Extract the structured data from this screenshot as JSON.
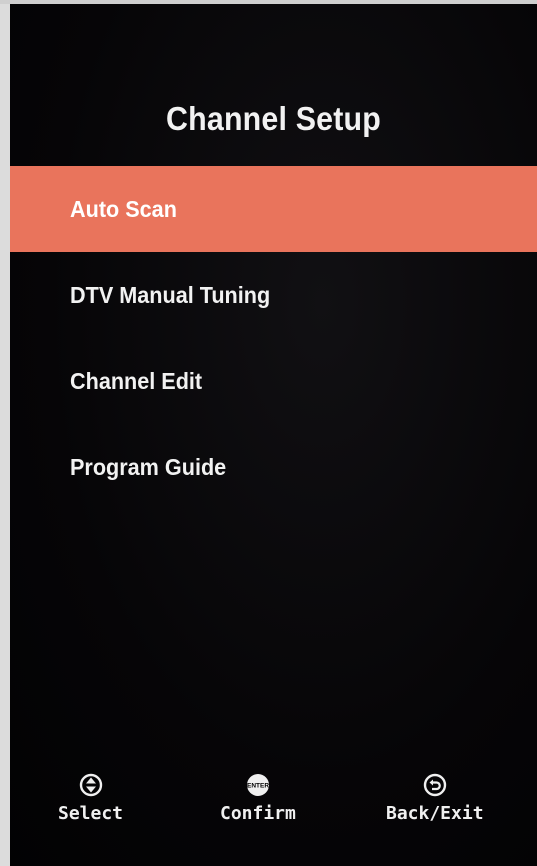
{
  "screen": {
    "title": "Channel Setup"
  },
  "menu": {
    "selected_index": 0,
    "selected_color": "#e9745c",
    "items": [
      {
        "label": "Auto Scan"
      },
      {
        "label": "DTV Manual Tuning"
      },
      {
        "label": "Channel Edit"
      },
      {
        "label": "Program Guide"
      }
    ]
  },
  "footer": {
    "select": {
      "label": "Select",
      "icon": "up-down-arrows-icon"
    },
    "confirm": {
      "label": "Confirm",
      "icon": "enter-icon",
      "icon_text": "ENTER"
    },
    "back": {
      "label": "Back/Exit",
      "icon": "return-arrow-icon"
    }
  }
}
